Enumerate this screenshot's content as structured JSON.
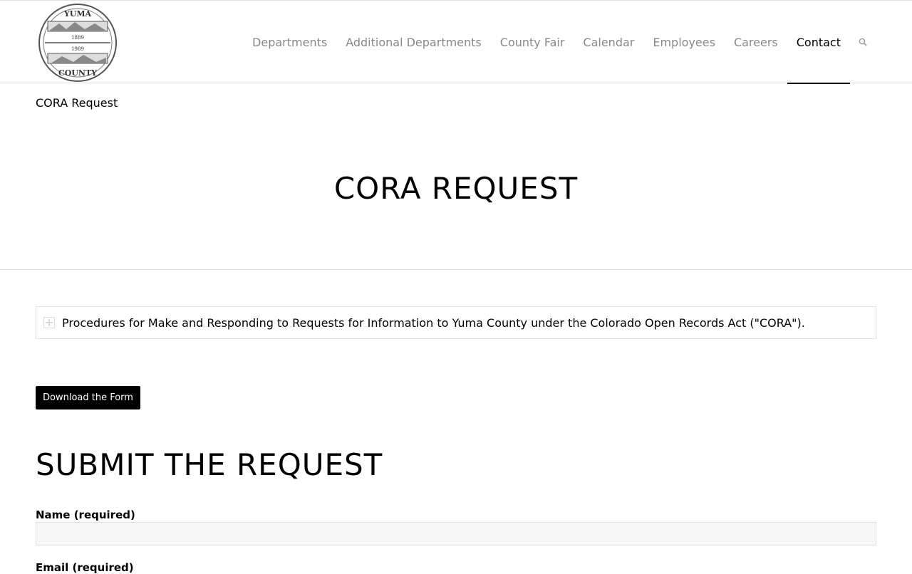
{
  "header": {
    "logo_alt": "Yuma County seal",
    "logo_text": {
      "top": "YUMA",
      "year_1": "1889",
      "year_2": "1989",
      "bottom": "COUNTY"
    },
    "nav": [
      {
        "label": "Departments",
        "active": false
      },
      {
        "label": "Additional Departments",
        "active": false
      },
      {
        "label": "County Fair",
        "active": false
      },
      {
        "label": "Calendar",
        "active": false
      },
      {
        "label": "Employees",
        "active": false
      },
      {
        "label": "Careers",
        "active": false
      },
      {
        "label": "Contact",
        "active": true
      }
    ],
    "search_icon": "search-icon"
  },
  "page": {
    "breadcrumb_title": "CORA Request",
    "hero_title": "CORA REQUEST"
  },
  "toggle": {
    "icon": "plus-square-icon",
    "label": "Procedures for Make and Responding to Requests for Information to Yuma County under the Colorado Open Records Act (\"CORA\")."
  },
  "download_button": {
    "label": "Download the Form"
  },
  "form": {
    "section_title": "SUBMIT THE REQUEST",
    "fields": [
      {
        "label": "Name (required)",
        "value": ""
      },
      {
        "label": "Email (required)",
        "value": ""
      }
    ]
  },
  "colors": {
    "nav_inactive": "#888888",
    "nav_active": "#000000",
    "button_bg": "#000000",
    "input_bg": "#f7f7f7",
    "border": "#e1e1e1"
  }
}
